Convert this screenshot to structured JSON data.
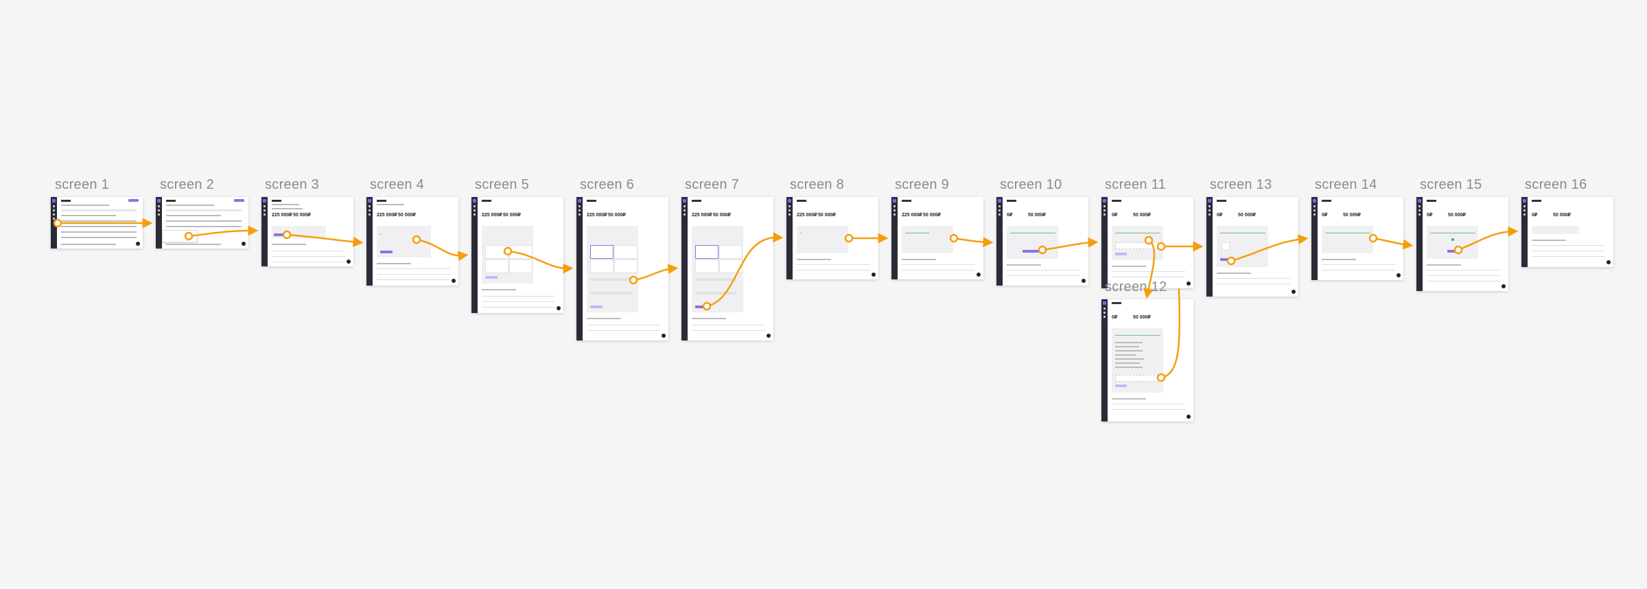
{
  "canvas": {
    "background": "#f5f5f5",
    "accent": "#f59e0b"
  },
  "screens": [
    {
      "id": "s1",
      "label": "screen 1"
    },
    {
      "id": "s2",
      "label": "screen 2"
    },
    {
      "id": "s3",
      "label": "screen 3",
      "balance": "225 000₽",
      "earned": "50 000₽"
    },
    {
      "id": "s4",
      "label": "screen 4",
      "balance": "225 000₽",
      "earned": "50 000₽"
    },
    {
      "id": "s5",
      "label": "screen 5",
      "balance": "225 000₽",
      "earned": "50 000₽"
    },
    {
      "id": "s6",
      "label": "screen 6",
      "balance": "225 000₽",
      "earned": "50 000₽"
    },
    {
      "id": "s7",
      "label": "screen 7",
      "balance": "225 000₽",
      "earned": "50 000₽"
    },
    {
      "id": "s8",
      "label": "screen 8",
      "balance": "225 000₽",
      "earned": "50 000₽"
    },
    {
      "id": "s9",
      "label": "screen 9",
      "balance": "225 000₽",
      "earned": "50 000₽"
    },
    {
      "id": "s10",
      "label": "screen 10",
      "balance": "0₽",
      "earned": "50 000₽"
    },
    {
      "id": "s11",
      "label": "screen 11",
      "balance": "0₽",
      "earned": "50 000₽"
    },
    {
      "id": "s12",
      "label": "screen 12",
      "balance": "0₽",
      "earned": "50 000₽"
    },
    {
      "id": "s13",
      "label": "screen 13",
      "balance": "0₽",
      "earned": "50 000₽"
    },
    {
      "id": "s14",
      "label": "screen 14",
      "balance": "0₽",
      "earned": "50 000₽"
    },
    {
      "id": "s15",
      "label": "screen 15",
      "balance": "0₽",
      "earned": "50 000₽"
    },
    {
      "id": "s16",
      "label": "screen 16",
      "balance": "0₽",
      "earned": "50 000₽"
    }
  ],
  "connections": [
    {
      "from": "screen 1",
      "to": "screen 2"
    },
    {
      "from": "screen 2",
      "to": "screen 3"
    },
    {
      "from": "screen 3",
      "to": "screen 4"
    },
    {
      "from": "screen 4",
      "to": "screen 5"
    },
    {
      "from": "screen 5",
      "to": "screen 6"
    },
    {
      "from": "screen 6",
      "to": "screen 7"
    },
    {
      "from": "screen 7",
      "to": "screen 8"
    },
    {
      "from": "screen 8",
      "to": "screen 9"
    },
    {
      "from": "screen 9",
      "to": "screen 10"
    },
    {
      "from": "screen 10",
      "to": "screen 11"
    },
    {
      "from": "screen 11",
      "to": "screen 12"
    },
    {
      "from": "screen 11",
      "to": "screen 13"
    },
    {
      "from": "screen 12",
      "to": "screen 13"
    },
    {
      "from": "screen 13",
      "to": "screen 14"
    },
    {
      "from": "screen 14",
      "to": "screen 15"
    },
    {
      "from": "screen 15",
      "to": "screen 16"
    }
  ]
}
